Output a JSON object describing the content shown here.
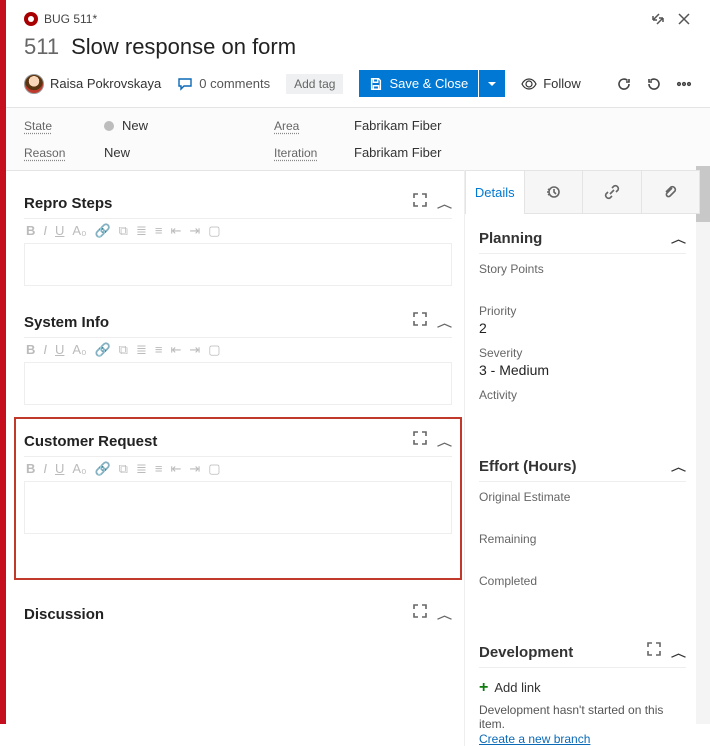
{
  "tab": {
    "label": "BUG 511*"
  },
  "workitem": {
    "id": "511",
    "title": "Slow response on form"
  },
  "assignee": {
    "name": "Raisa Pokrovskaya"
  },
  "comments": {
    "label": "0 comments"
  },
  "tags": {
    "add_label": "Add tag"
  },
  "actions": {
    "save_close": "Save & Close",
    "follow": "Follow"
  },
  "meta": {
    "state_label": "State",
    "state_value": "New",
    "reason_label": "Reason",
    "reason_value": "New",
    "area_label": "Area",
    "area_value": "Fabrikam Fiber",
    "iteration_label": "Iteration",
    "iteration_value": "Fabrikam Fiber"
  },
  "sections": {
    "repro": "Repro Steps",
    "systeminfo": "System Info",
    "customer": "Customer Request",
    "discussion": "Discussion"
  },
  "right_tabs": {
    "details": "Details"
  },
  "planning": {
    "title": "Planning",
    "story_points_label": "Story Points",
    "story_points_value": "",
    "priority_label": "Priority",
    "priority_value": "2",
    "severity_label": "Severity",
    "severity_value": "3 - Medium",
    "activity_label": "Activity",
    "activity_value": ""
  },
  "effort": {
    "title": "Effort (Hours)",
    "original_label": "Original Estimate",
    "remaining_label": "Remaining",
    "completed_label": "Completed"
  },
  "development": {
    "title": "Development",
    "add_link": "Add link",
    "note": "Development hasn't started on this item.",
    "create_branch": "Create a new branch"
  }
}
